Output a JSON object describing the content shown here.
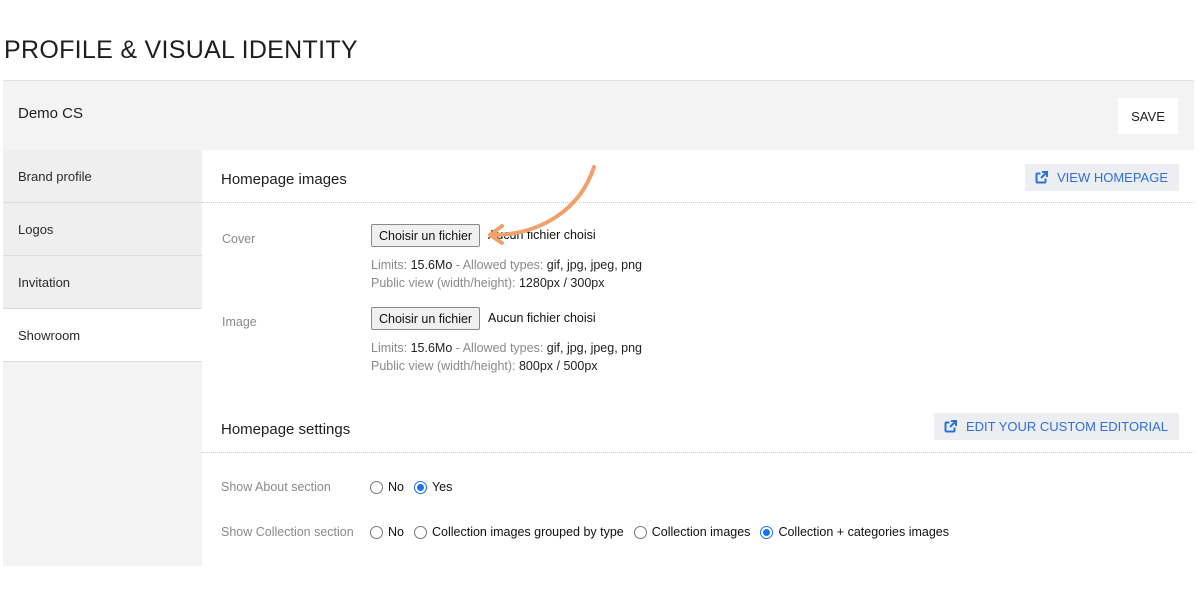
{
  "page": {
    "title": "PROFILE & VISUAL IDENTITY"
  },
  "header": {
    "org_name": "Demo CS",
    "save_label": "SAVE"
  },
  "sidebar": {
    "items": [
      {
        "label": "Brand profile"
      },
      {
        "label": "Logos"
      },
      {
        "label": "Invitation"
      },
      {
        "label": "Showroom",
        "active": true
      }
    ]
  },
  "homepage_images": {
    "title": "Homepage images",
    "view_homepage_label": "VIEW HOMEPAGE",
    "cover": {
      "label": "Cover",
      "button_label": "Choisir un fichier",
      "status": "Aucun fichier choisi",
      "limits_prefix": "Limits: ",
      "limits_value": "15.6Mo",
      "types_prefix": " - Allowed types: ",
      "types_value": "gif, jpg, jpeg, png",
      "view_prefix": "Public view (width/height): ",
      "view_value": "1280px / 300px"
    },
    "image": {
      "label": "Image",
      "button_label": "Choisir un fichier",
      "status": "Aucun fichier choisi",
      "limits_prefix": "Limits: ",
      "limits_value": "15.6Mo",
      "types_prefix": " - Allowed types: ",
      "types_value": "gif, jpg, jpeg, png",
      "view_prefix": "Public view (width/height): ",
      "view_value": "800px / 500px"
    }
  },
  "homepage_settings": {
    "title": "Homepage settings",
    "edit_editorial_label": "EDIT YOUR CUSTOM EDITORIAL",
    "about": {
      "label": "Show About section",
      "options": [
        "No",
        "Yes"
      ],
      "selected": "Yes"
    },
    "collection": {
      "label": "Show Collection section",
      "options": [
        "No",
        "Collection images grouped by type",
        "Collection images",
        "Collection + categories images"
      ],
      "selected": "Collection + categories images"
    }
  },
  "colors": {
    "accent": "#2f6fd8",
    "arrow": "#f2a06c",
    "radio": "#1a73e8"
  },
  "icons": {
    "external": "external-link-icon",
    "arrow": "curved-arrow-icon"
  }
}
